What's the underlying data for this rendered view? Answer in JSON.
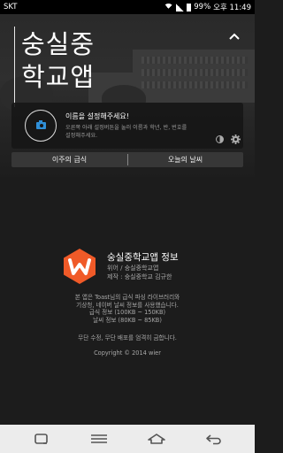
{
  "status_bar": {
    "carrier": "SKT",
    "battery": "99%",
    "time": "오후 11:49"
  },
  "header": {
    "title_line1": "숭실중",
    "title_line2": "학교앱"
  },
  "profile": {
    "name_prompt": "이름을 설정해주세요!",
    "hint_line1": "오른쪽 아래 설정버튼을 눌러 이름과 학년, 반, 번호를",
    "hint_line2": "설정해주세요."
  },
  "tabs": [
    {
      "label": "이주의 급식"
    },
    {
      "label": "오늘의 날씨"
    }
  ],
  "app_info": {
    "title": "숭실중학교앱 정보",
    "author": "위어 / 숭실중학교앱",
    "producer": "제작 : 숭실중학교 김규한",
    "desc_lines": [
      "본 앱은 Toast님의 급식 파싱 라이브러리와",
      "기상청, 네이버 날씨 정보를 사용했습니다.",
      "급식 정보 (100KB ~ 150KB)",
      "날씨 정보 (80KB ~ 85KB)"
    ],
    "notice": "무단 수정, 무단 배포를 엄격히 금합니다.",
    "copyright": "Copyright © 2014 wier"
  },
  "colors": {
    "logo_orange": "#f05a28",
    "camera_blue": "#2f8fd8"
  },
  "icons": {
    "collapse": "chevron-up-icon",
    "camera": "camera-icon",
    "theme": "contrast-icon",
    "settings": "gear-icon",
    "logo": "w-logo-icon",
    "nav_recent": "recent-apps-icon",
    "nav_menu": "menu-icon",
    "nav_home": "home-icon",
    "nav_back": "back-icon"
  }
}
